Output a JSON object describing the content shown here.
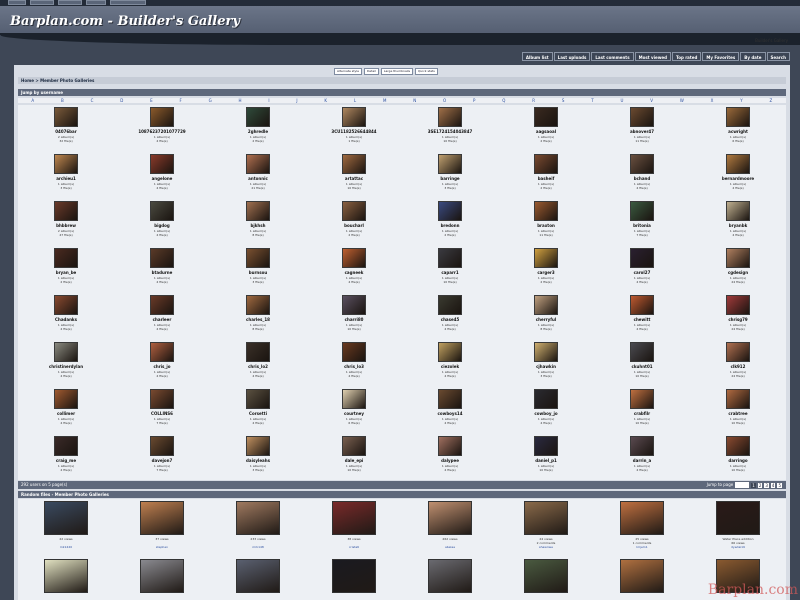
{
  "site": {
    "title": "Barplan.com - Builder's Gallery"
  },
  "user_link": "Builder's Gallery",
  "nav": [
    "Album list",
    "Last uploads",
    "Last comments",
    "Most viewed",
    "Top rated",
    "My Favorites",
    "By date",
    "Search"
  ],
  "view_links": [
    "Alternate style",
    "Detail",
    "Large thumbnails",
    "Quick stats"
  ],
  "breadcrumb": "Home > Member Photo Galleries",
  "jump_label": "Jump by username",
  "letters": [
    "A",
    "B",
    "C",
    "D",
    "E",
    "F",
    "G",
    "H",
    "I",
    "J",
    "K",
    "L",
    "M",
    "N",
    "O",
    "P",
    "Q",
    "R",
    "S",
    "T",
    "U",
    "V",
    "W",
    "X",
    "Y",
    "Z"
  ],
  "users": [
    {
      "name": "04076bar",
      "albums": "2 album(s)",
      "files": "32 file(s)",
      "color": "#7a5a3a"
    },
    {
      "name": "10876237201077729",
      "albums": "1 album(s)",
      "files": "4 file(s)",
      "color": "#8b5a2b"
    },
    {
      "name": "2ghredle",
      "albums": "1 album(s)",
      "files": "2 file(s)",
      "color": "#2f4a3a"
    },
    {
      "name": "3CU1182526644844",
      "albums": "1 album(s)",
      "files": "1 file(s)",
      "color": "#b08860"
    },
    {
      "name": "3SE1724154043847",
      "albums": "1 album(s)",
      "files": "10 file(s)",
      "color": "#a07048"
    },
    {
      "name": "aagsaoal",
      "albums": "1 album(s)",
      "files": "2 file(s)",
      "color": "#3a2a20"
    },
    {
      "name": "abnover47",
      "albums": "1 album(s)",
      "files": "11 file(s)",
      "color": "#6b4a30"
    },
    {
      "name": "acwright",
      "albums": "1 album(s)",
      "files": "6 file(s)",
      "color": "#9a6a3a"
    },
    {
      "name": "archieu1",
      "albums": "1 album(s)",
      "files": "3 file(s)",
      "color": "#c08850"
    },
    {
      "name": "angelone",
      "albums": "1 album(s)",
      "files": "4 file(s)",
      "color": "#8a3a2a"
    },
    {
      "name": "antonnic",
      "albums": "1 album(s)",
      "files": "21 file(s)",
      "color": "#b07050"
    },
    {
      "name": "artattac",
      "albums": "1 album(s)",
      "files": "10 file(s)",
      "color": "#a06a40"
    },
    {
      "name": "barringe",
      "albums": "1 album(s)",
      "files": "3 file(s)",
      "color": "#c0a070"
    },
    {
      "name": "basheif",
      "albums": "1 album(s)",
      "files": "2 file(s)",
      "color": "#7a4a30"
    },
    {
      "name": "bchand",
      "albums": "1 album(s)",
      "files": "4 file(s)",
      "color": "#6a5040"
    },
    {
      "name": "bernardmoore",
      "albums": "1 album(s)",
      "files": "4 file(s)",
      "color": "#b07a40"
    },
    {
      "name": "bhbbrew",
      "albums": "2 album(s)",
      "files": "47 file(s)",
      "color": "#6a3a2a"
    },
    {
      "name": "bigdog",
      "albums": "1 album(s)",
      "files": "4 file(s)",
      "color": "#4a4a40"
    },
    {
      "name": "bjkhsh",
      "albums": "1 album(s)",
      "files": "8 file(s)",
      "color": "#a07050"
    },
    {
      "name": "boucharl",
      "albums": "1 album(s)",
      "files": "2 file(s)",
      "color": "#8a6040"
    },
    {
      "name": "bredonn",
      "albums": "1 album(s)",
      "files": "2 file(s)",
      "color": "#3a4a80"
    },
    {
      "name": "braxton",
      "albums": "1 album(s)",
      "files": "11 file(s)",
      "color": "#9a5a30"
    },
    {
      "name": "britonia",
      "albums": "1 album(s)",
      "files": "7 file(s)",
      "color": "#3a5a40"
    },
    {
      "name": "bryanbk",
      "albums": "1 album(s)",
      "files": "4 file(s)",
      "color": "#c0b090"
    },
    {
      "name": "bryan_be",
      "albums": "1 album(s)",
      "files": "2 file(s)",
      "color": "#4a2a20"
    },
    {
      "name": "btadurne",
      "albums": "1 album(s)",
      "files": "4 file(s)",
      "color": "#5a3a28"
    },
    {
      "name": "burnsou",
      "albums": "1 album(s)",
      "files": "3 file(s)",
      "color": "#7a5030"
    },
    {
      "name": "cagneek",
      "albums": "1 album(s)",
      "files": "4 file(s)",
      "color": "#c06030"
    },
    {
      "name": "caparr1",
      "albums": "1 album(s)",
      "files": "10 file(s)",
      "color": "#3a3a40"
    },
    {
      "name": "carger3",
      "albums": "1 album(s)",
      "files": "2 file(s)",
      "color": "#d0a040"
    },
    {
      "name": "carol27",
      "albums": "1 album(s)",
      "files": "4 file(s)",
      "color": "#2a2030"
    },
    {
      "name": "cgdesign",
      "albums": "1 album(s)",
      "files": "24 file(s)",
      "color": "#b08060"
    },
    {
      "name": "Chadanks",
      "albums": "1 album(s)",
      "files": "4 file(s)",
      "color": "#8a4a30"
    },
    {
      "name": "charleer",
      "albums": "1 album(s)",
      "files": "4 file(s)",
      "color": "#6a3a28"
    },
    {
      "name": "charles_18",
      "albums": "1 album(s)",
      "files": "8 file(s)",
      "color": "#a06a40"
    },
    {
      "name": "charri80",
      "albums": "1 album(s)",
      "files": "10 file(s)",
      "color": "#5a5060"
    },
    {
      "name": "chase45",
      "albums": "1 album(s)",
      "files": "4 file(s)",
      "color": "#3a3a30"
    },
    {
      "name": "cherryful",
      "albums": "1 album(s)",
      "files": "8 file(s)",
      "color": "#c0a080"
    },
    {
      "name": "chewitt",
      "albums": "1 album(s)",
      "files": "4 file(s)",
      "color": "#c05a30"
    },
    {
      "name": "chrisg79",
      "albums": "1 album(s)",
      "files": "24 file(s)",
      "color": "#a03a3a"
    },
    {
      "name": "christinerdylan",
      "albums": "1 album(s)",
      "files": "4 file(s)",
      "color": "#8a8a80"
    },
    {
      "name": "chris_jo",
      "albums": "1 album(s)",
      "files": "4 file(s)",
      "color": "#b06040"
    },
    {
      "name": "chris_lo2",
      "albums": "1 album(s)",
      "files": "4 file(s)",
      "color": "#3a3028"
    },
    {
      "name": "chris_lo3",
      "albums": "1 album(s)",
      "files": "4 file(s)",
      "color": "#6a3a20"
    },
    {
      "name": "ciezolek",
      "albums": "1 album(s)",
      "files": "4 file(s)",
      "color": "#c0a060"
    },
    {
      "name": "cjhawkin",
      "albums": "1 album(s)",
      "files": "3 file(s)",
      "color": "#d0b070"
    },
    {
      "name": "ckuhnt01",
      "albums": "1 album(s)",
      "files": "10 file(s)",
      "color": "#4a4a50"
    },
    {
      "name": "clk912",
      "albums": "1 album(s)",
      "files": "24 file(s)",
      "color": "#b07050"
    },
    {
      "name": "collimer",
      "albums": "1 album(s)",
      "files": "4 file(s)",
      "color": "#a05a30"
    },
    {
      "name": "COLLINS6",
      "albums": "1 album(s)",
      "files": "7 file(s)",
      "color": "#7a4a30"
    },
    {
      "name": "Corsetti",
      "albums": "1 album(s)",
      "files": "4 file(s)",
      "color": "#5a5040"
    },
    {
      "name": "courtney",
      "albums": "1 album(s)",
      "files": "6 file(s)",
      "color": "#e0d0b0"
    },
    {
      "name": "cowboys14",
      "albums": "1 album(s)",
      "files": "4 file(s)",
      "color": "#6a4a30"
    },
    {
      "name": "cowboy_jo",
      "albums": "1 album(s)",
      "files": "4 file(s)",
      "color": "#2a2a30"
    },
    {
      "name": "crabfilr",
      "albums": "1 album(s)",
      "files": "10 file(s)",
      "color": "#c07040"
    },
    {
      "name": "crabtree",
      "albums": "1 album(s)",
      "files": "10 file(s)",
      "color": "#b06a40"
    },
    {
      "name": "craig_me",
      "albums": "1 album(s)",
      "files": "4 file(s)",
      "color": "#3a2a28"
    },
    {
      "name": "davejon7",
      "albums": "1 album(s)",
      "files": "7 file(s)",
      "color": "#6a4a30"
    },
    {
      "name": "daisyleahs",
      "albums": "1 album(s)",
      "files": "3 file(s)",
      "color": "#c09060"
    },
    {
      "name": "dale_epi",
      "albums": "1 album(s)",
      "files": "10 file(s)",
      "color": "#7a6050"
    },
    {
      "name": "dalypee",
      "albums": "1 album(s)",
      "files": "4 file(s)",
      "color": "#a07060"
    },
    {
      "name": "daniel_p1",
      "albums": "1 album(s)",
      "files": "10 file(s)",
      "color": "#2a2a40"
    },
    {
      "name": "darrin_a",
      "albums": "1 album(s)",
      "files": "4 file(s)",
      "color": "#5a4a50"
    },
    {
      "name": "darringo",
      "albums": "1 album(s)",
      "files": "10 file(s)",
      "color": "#8a4a30"
    }
  ],
  "pager": {
    "summary": "292 users on 5 page(s)",
    "jump_label": "Jump to page",
    "pages": [
      "1",
      "2",
      "3",
      "4",
      "5"
    ]
  },
  "random_title": "Random files - Member Photo Galleries",
  "random_files": [
    {
      "views": "22 views",
      "comments": "",
      "owner": "mk1420",
      "color": "#3a4a60"
    },
    {
      "views": "37 views",
      "comments": "",
      "owner": "stephen",
      "color": "#c08050"
    },
    {
      "views": "233 views",
      "comments": "",
      "owner": "mrk148",
      "color": "#a07a60"
    },
    {
      "views": "38 views",
      "comments": "",
      "owner": "crista6",
      "color": "#7a2a2a"
    },
    {
      "views": "262 views",
      "comments": "",
      "owner": "abelae",
      "color": "#c09070"
    },
    {
      "views": "24 views",
      "comments": "2 comments",
      "owner": "shawnwe",
      "color": "#8a6a4a"
    },
    {
      "views": "25 views",
      "comments": "1 comments",
      "owner": "lmjem1",
      "color": "#c07040"
    },
    {
      "views": "Water Place addition",
      "comments": "66 views",
      "owner": "dyedai19",
      "color": "#2a1a18"
    },
    {
      "views": "",
      "comments": "",
      "owner": "",
      "color": "#e0e0c0"
    },
    {
      "views": "",
      "comments": "",
      "owner": "",
      "color": "#8a8a90"
    },
    {
      "views": "",
      "comments": "",
      "owner": "",
      "color": "#5a6070"
    },
    {
      "views": "",
      "comments": "",
      "owner": "",
      "color": "#1a1a20"
    },
    {
      "views": "",
      "comments": "",
      "owner": "",
      "color": "#6a6a70"
    },
    {
      "views": "",
      "comments": "",
      "owner": "",
      "color": "#4a5a40"
    },
    {
      "views": "",
      "comments": "",
      "owner": "",
      "color": "#b07040"
    },
    {
      "views": "",
      "comments": "",
      "owner": "",
      "color": "#8a5a30"
    }
  ],
  "watermark": "Barplan.com"
}
